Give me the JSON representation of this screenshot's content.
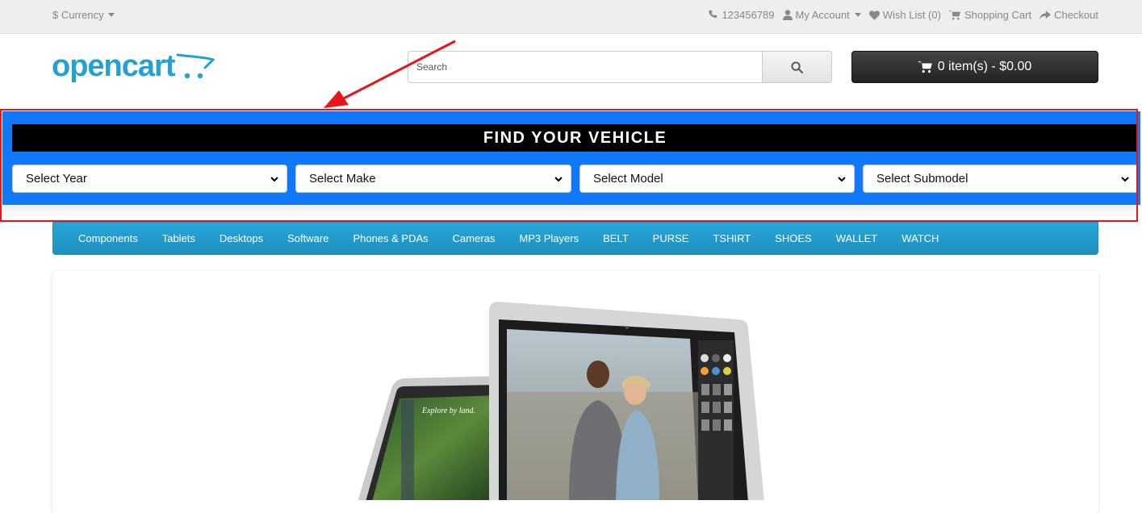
{
  "topbar": {
    "currency_label": "$ Currency",
    "phone": "123456789",
    "my_account": "My Account",
    "wish_list": "Wish List (0)",
    "shopping_cart": "Shopping Cart",
    "checkout": "Checkout"
  },
  "header": {
    "logo_text": "opencart",
    "search_placeholder": "Search",
    "cart_label": "0 item(s) - $0.00"
  },
  "finder": {
    "title": "FIND YOUR VEHICLE",
    "selects": [
      "Select Year",
      "Select Make",
      "Select Model",
      "Select Submodel"
    ]
  },
  "menu": {
    "items": [
      "Components",
      "Tablets",
      "Desktops",
      "Software",
      "Phones & PDAs",
      "Cameras",
      "MP3 Players",
      "BELT",
      "PURSE",
      "TSHIRT",
      "SHOES",
      "WALLET",
      "WATCH"
    ]
  },
  "slideshow": {
    "screen_caption": "Explore by land."
  },
  "colors": {
    "finder_bg": "#0f78fb",
    "menu_bg": "#229ac8",
    "logo": "#23a1d1",
    "annotation": "#e8161b"
  }
}
